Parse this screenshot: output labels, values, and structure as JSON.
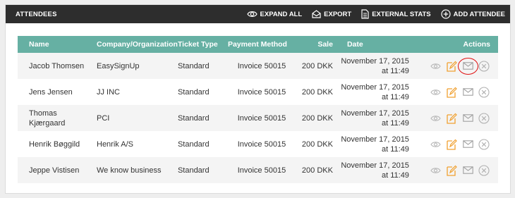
{
  "header": {
    "title": "ATTENDEES",
    "actions": [
      {
        "label": "EXPAND ALL",
        "icon": "eye-icon"
      },
      {
        "label": "EXPORT",
        "icon": "export-icon"
      },
      {
        "label": "EXTERNAL STATS",
        "icon": "document-icon"
      },
      {
        "label": "ADD ATTENDEE",
        "icon": "add-circle-icon"
      }
    ]
  },
  "table": {
    "columns": [
      "Name",
      "Company/Organization",
      "Ticket Type",
      "Payment Method",
      "Sale",
      "Date",
      "Actions"
    ],
    "rows": [
      {
        "name1": "Jacob Thomsen",
        "name2": "",
        "company": "EasySignUp",
        "ticket": "Standard",
        "payment": "Invoice 50015",
        "sale": "200 DKK",
        "date1": "November 17, 2015",
        "date2": "at 11:49"
      },
      {
        "name1": "Jens Jensen",
        "name2": "",
        "company": "JJ INC",
        "ticket": "Standard",
        "payment": "Invoice 50015",
        "sale": "200 DKK",
        "date1": "November 17, 2015",
        "date2": "at 11:49"
      },
      {
        "name1": "Thomas",
        "name2": "Kjærgaard",
        "company": "PCI",
        "ticket": "Standard",
        "payment": "Invoice 50015",
        "sale": "200 DKK",
        "date1": "November 17, 2015",
        "date2": "at 11:49"
      },
      {
        "name1": "Henrik Bøggild",
        "name2": "",
        "company": "Henrik A/S",
        "ticket": "Standard",
        "payment": "Invoice 50015",
        "sale": "200 DKK",
        "date1": "November 17, 2015",
        "date2": "at 11:49"
      },
      {
        "name1": "Jeppe Vistisen",
        "name2": "",
        "company": "We know business",
        "ticket": "Standard",
        "payment": "Invoice 50015",
        "sale": "200 DKK",
        "date1": "November 17, 2015",
        "date2": "at 11:49"
      }
    ],
    "row_actions": [
      "eye-icon",
      "edit-icon",
      "mail-icon",
      "delete-icon"
    ]
  },
  "colors": {
    "topbar": "#2d2d2d",
    "table_header": "#66b0a3",
    "edit_icon": "#f0a030",
    "highlight_circle": "#e01010",
    "muted_icon": "#b5b5b5"
  }
}
